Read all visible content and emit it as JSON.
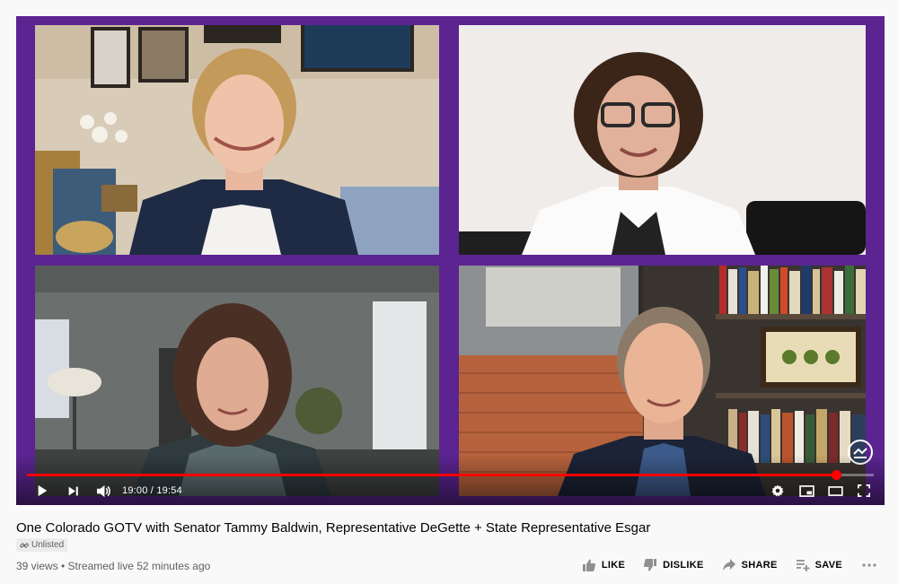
{
  "player": {
    "current_time": "19:00",
    "separator": "/",
    "duration": "19:54",
    "progress": 0.955,
    "colors": {
      "frame": "#5b2491",
      "progress": "#ff0000"
    }
  },
  "video": {
    "title": "One Colorado GOTV with Senator Tammy Baldwin, Representative DeGette + State Representative Esgar",
    "visibility": "Unlisted",
    "stats": "39 views • Streamed live 52 minutes ago"
  },
  "actions": {
    "like": "LIKE",
    "dislike": "DISLIKE",
    "share": "SHARE",
    "save": "SAVE"
  },
  "icons": [
    "play-icon",
    "next-icon",
    "volume-icon",
    "settings-icon",
    "miniplayer-icon",
    "theater-icon",
    "fullscreen-icon",
    "link-icon",
    "thumbs-up-icon",
    "thumbs-down-icon",
    "share-icon",
    "playlist-add-icon",
    "more-icon"
  ]
}
